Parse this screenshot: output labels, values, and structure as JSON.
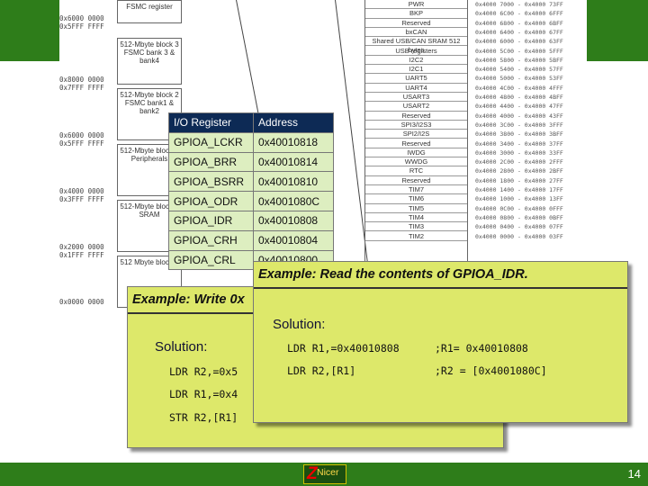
{
  "memory_map_left": {
    "addresses": [
      "0x6000 0000",
      "0x5FFF FFFF",
      "0x8000 0000",
      "0x7FFF FFFF",
      "0x6000 0000",
      "0x5FFF FFFF",
      "0x4000 0000",
      "0x3FFF FFFF",
      "0x2000 0000",
      "0x1FFF FFFF",
      "0x0000 0000"
    ],
    "blocks": [
      "FSMC register",
      "512-Mbyte block 3 FSMC bank 3 & bank4",
      "512-Mbyte block 2 FSMC bank1 & bank2",
      "512-Mbyte block 2 Peripherals",
      "512-Mbyte block 1 SRAM",
      "512 Mbyte block 0"
    ]
  },
  "memory_map_right": {
    "cells": [
      "PWR",
      "BKP",
      "Reserved",
      "bxCAN",
      "Shared USB/CAN SRAM 512 bytes",
      "USB registers",
      "I2C2",
      "I2C1",
      "UART5",
      "UART4",
      "USART3",
      "USART2",
      "Reserved",
      "SPI3/I2S3",
      "SPI2/I2S",
      "Reserved",
      "IWDG",
      "WWDG",
      "RTC",
      "Reserved",
      "TIM7",
      "TIM6",
      "TIM5",
      "TIM4",
      "TIM3",
      "TIM2"
    ],
    "addresses": [
      "0x4000 7000 - 0x4000 73FF",
      "0x4000 6C00 - 0x4000 6FFF",
      "0x4000 6800 - 0x4000 6BFF",
      "0x4000 6400 - 0x4000 67FF",
      "0x4000 6000 - 0x4000 63FF",
      "0x4000 5C00 - 0x4000 5FFF",
      "0x4000 5800 - 0x4000 5BFF",
      "0x4000 5400 - 0x4000 57FF",
      "0x4000 5000 - 0x4000 53FF",
      "0x4000 4C00 - 0x4000 4FFF",
      "0x4000 4800 - 0x4000 4BFF",
      "0x4000 4400 - 0x4000 47FF",
      "0x4000 4000 - 0x4000 43FF",
      "0x4000 3C00 - 0x4000 3FFF",
      "0x4000 3800 - 0x4000 3BFF",
      "0x4000 3400 - 0x4000 37FF",
      "0x4000 3000 - 0x4000 33FF",
      "0x4000 2C00 - 0x4000 2FFF",
      "0x4000 2800 - 0x4000 2BFF",
      "0x4000 1800 - 0x4000 27FF",
      "0x4000 1400 - 0x4000 17FF",
      "0x4000 1000 - 0x4000 13FF",
      "0x4000 0C00 - 0x4000 0FFF",
      "0x4000 0800 - 0x4000 0BFF",
      "0x4000 0400 - 0x4000 07FF",
      "0x4000 0000 - 0x4000 03FF"
    ]
  },
  "register_table": {
    "headers": [
      "I/O Register",
      "Address"
    ],
    "rows": [
      [
        "GPIOA_LCKR",
        "0x40010818"
      ],
      [
        "GPIOA_BRR",
        "0x40010814"
      ],
      [
        "GPIOA_BSRR",
        "0x40010810"
      ],
      [
        "GPIOA_ODR",
        "0x4001080C"
      ],
      [
        "GPIOA_IDR",
        "0x40010808"
      ],
      [
        "GPIOA_CRH",
        "0x40010804"
      ],
      [
        "GPIOA_CRL",
        "0x40010800"
      ]
    ]
  },
  "example_write": {
    "title": "Example: Write 0x",
    "solution_label": "Solution:",
    "code": [
      "LDR R2,=0x5",
      "LDR R1,=0x4",
      "STR R2,[R1]"
    ]
  },
  "example_read": {
    "title": "Example: Read the contents of GPIOA_IDR.",
    "solution_label": "Solution:",
    "code": [
      {
        "instr": "LDR R1,=0x40010808",
        "comment": ";R1= 0x40010808"
      },
      {
        "instr": "LDR R2,[R1]",
        "comment": ";R2 = [0x4001080C]"
      }
    ]
  },
  "footer": {
    "logo_letter": "Z",
    "logo_text": "Nicer",
    "page_number": "14"
  },
  "colors": {
    "frame_green": "#2e7d1a",
    "box_yellow": "#dde86a",
    "table_header": "#0d2a55",
    "table_cell": "#ddeec0"
  }
}
